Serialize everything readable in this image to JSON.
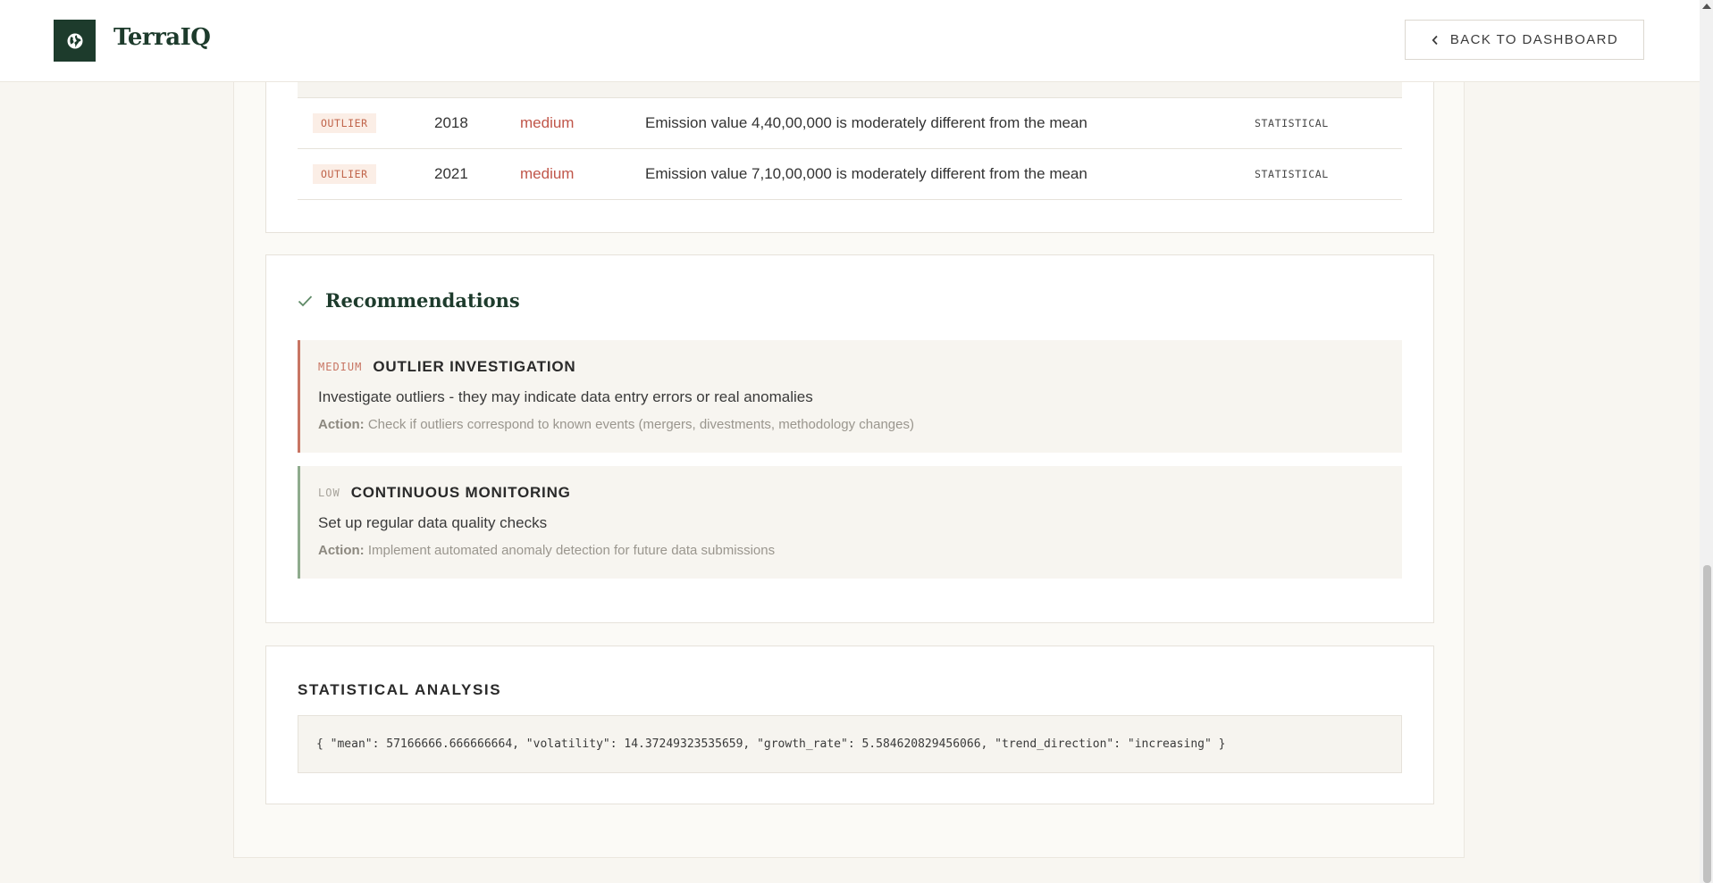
{
  "header": {
    "brand": "TerraIQ",
    "back_label": "BACK TO DASHBOARD"
  },
  "anomalies": {
    "rows": [
      {
        "type": "OUTLIER",
        "year": "2018",
        "severity": "medium",
        "description": "Emission value 4,40,00,000 is moderately different from the mean",
        "method": "STATISTICAL"
      },
      {
        "type": "OUTLIER",
        "year": "2021",
        "severity": "medium",
        "description": "Emission value 7,10,00,000 is moderately different from the mean",
        "method": "STATISTICAL"
      }
    ]
  },
  "recommendations": {
    "title": "Recommendations",
    "action_prefix": "Action:",
    "items": [
      {
        "priority": "MEDIUM",
        "title": "OUTLIER INVESTIGATION",
        "description": "Investigate outliers - they may indicate data entry errors or real anomalies",
        "action": "Check if outliers correspond to known events (mergers, divestments, methodology changes)"
      },
      {
        "priority": "LOW",
        "title": "CONTINUOUS MONITORING",
        "description": "Set up regular data quality checks",
        "action": "Implement automated anomaly detection for future data submissions"
      }
    ]
  },
  "statistical_analysis": {
    "title": "STATISTICAL ANALYSIS",
    "json_text": "{ \"mean\": 57166666.666666664, \"volatility\": 14.37249323535659, \"growth_rate\": 5.58462082945606​6, \"trend_direction\": \"increasing\" }"
  },
  "colors": {
    "brand_green": "#1d3b2c",
    "medium_accent": "#c87563",
    "low_accent": "#8fab8d",
    "severity_medium": "#c0564a"
  },
  "icons": {
    "logo": "globe-icon",
    "back": "chevron-left-icon",
    "recommendations": "check-icon"
  }
}
